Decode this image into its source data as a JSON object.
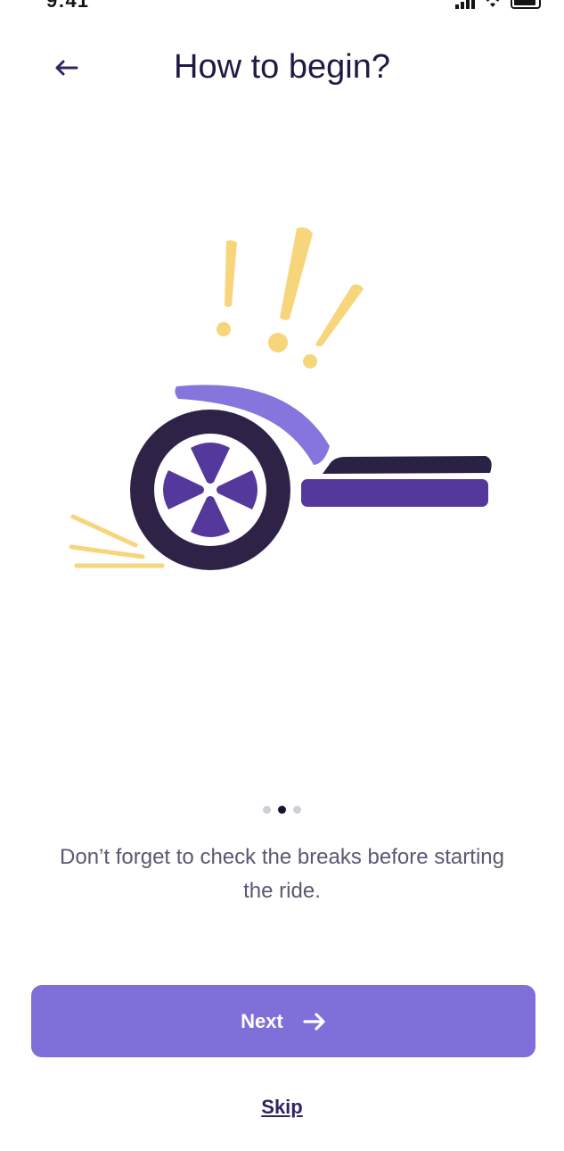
{
  "status_bar": {
    "time": "9:41",
    "icons": [
      "signal-icon",
      "wifi-icon",
      "battery-icon"
    ]
  },
  "header": {
    "back_icon": "arrow-left-icon",
    "title": "How to begin?"
  },
  "illustration": {
    "subject": "hoverboard-with-exclamation-marks",
    "colors": {
      "accent_yellow": "#f7d57a",
      "wheel_dark": "#2e2347",
      "purple_light": "#8575dc",
      "purple_mid": "#55389c",
      "deck_dark": "#2a2244"
    }
  },
  "pager": {
    "count": 3,
    "active_index": 1
  },
  "onboarding": {
    "description": "Don’t forget to check the breaks before starting the ride."
  },
  "actions": {
    "next_label": "Next",
    "next_icon": "arrow-right-icon",
    "skip_label": "Skip"
  },
  "colors": {
    "primary": "#7f6fd9",
    "title_text": "#1e1a44",
    "body_text": "#5b5872",
    "link_text": "#2d2563"
  }
}
